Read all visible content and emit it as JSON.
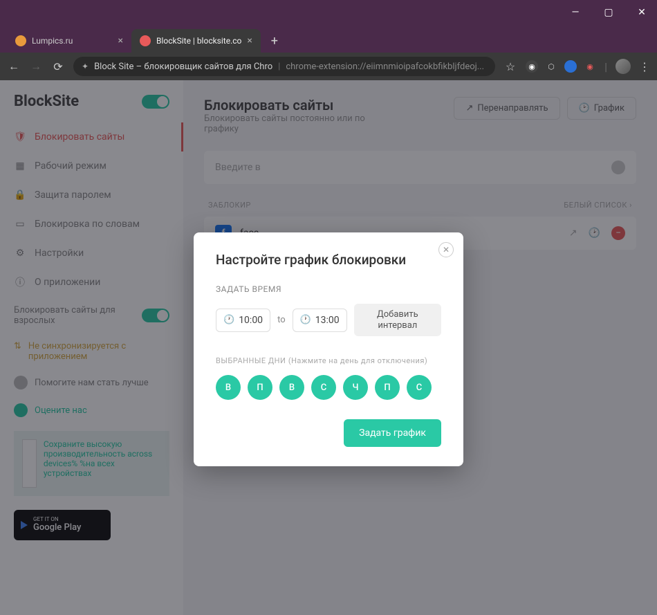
{
  "window": {
    "tabs": [
      {
        "title": "Lumpics.ru",
        "favicon_color": "#e89a3c"
      },
      {
        "title": "BlockSite | blocksite.co",
        "favicon_color": "#e85a5a"
      }
    ],
    "url_prefix": "Block Site – блокировщик сайтов для Chro",
    "url_suffix": "chrome-extension://eiimnmioipafcokbfikbljfdeoj..."
  },
  "sidebar": {
    "logo": "BlockSite",
    "items": [
      {
        "label": "Блокировать сайты"
      },
      {
        "label": "Рабочий режим"
      },
      {
        "label": "Защита паролем"
      },
      {
        "label": "Блокировка по словам"
      },
      {
        "label": "Настройки"
      },
      {
        "label": "О приложении"
      }
    ],
    "adult_label": "Блокировать сайты для взрослых",
    "sync_label": "Не синхронизируется с приложением",
    "help_label": "Помогите нам стать лучше",
    "rate_label": "Оцените нас",
    "ad_text": "Сохраните высокую производительность across devices% %на всех устройствах",
    "play_small": "GET IT ON",
    "play_big": "Google Play"
  },
  "main": {
    "title": "Блокировать сайты",
    "subtitle": "Блокировать сайты постоянно или по графику",
    "redirect_btn": "Перенаправлять",
    "schedule_btn": "График",
    "input_placeholder": "Введите в",
    "blocked_label": "ЗАБЛОКИР",
    "whitelist_label": "Белый список",
    "site_name": "face"
  },
  "modal": {
    "title": "Настройте график блокировки",
    "time_section": "ЗАДАТЬ ВРЕМЯ",
    "time_from": "10:00",
    "time_to_label": "to",
    "time_to": "13:00",
    "add_interval": "Добавить интервал",
    "days_section": "ВЫБРАННЫЕ ДНИ",
    "days_hint": "(Нажмите на день для отключения)",
    "days": [
      "В",
      "П",
      "В",
      "С",
      "Ч",
      "П",
      "С"
    ],
    "submit": "Задать график"
  }
}
